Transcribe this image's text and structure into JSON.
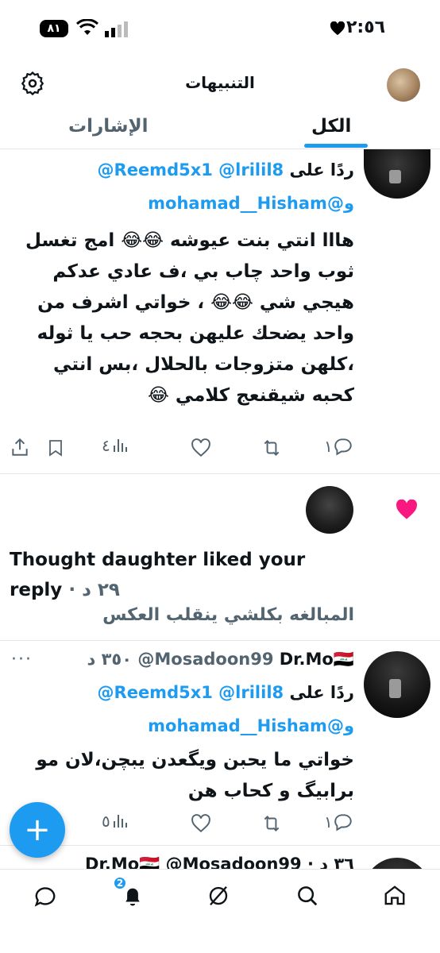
{
  "status_bar": {
    "time": "٢:٥٦",
    "battery": "٨١"
  },
  "header": {
    "title": "التنبيهات",
    "tabs": [
      {
        "label": "الكل"
      },
      {
        "label": "الإشارات"
      }
    ]
  },
  "tweets": [
    {
      "reply_prefix": "ردًا على",
      "mentions_line1": "@Reemd5x1 @lrilil8",
      "mentions_line2": "و@mohamad__Hisham",
      "body": "هااا انتي بنت عيوشه 😂😂 امج تغسل ثوب واحد چاب بي ،ف عادي عدكم هيجي شي 😂😂 ، خواتي اشرف من واحد يضحك عليهن بحجه حب يا ثوله ،كلهن متزوجات بالحلال ،بس انتي كحبه شيقنعج كلامي 😂",
      "replies": "١",
      "views": "٤"
    },
    {
      "name": "Dr.Mo🇮🇶",
      "handle": "@Mosadoon99",
      "time": "٣٥٠ د",
      "reply_prefix": "ردًا على",
      "mentions_line1": "@Reemd5x1 @lrilil8",
      "mentions_line2": "و@mohamad__Hisham",
      "body": "خواتي ما يحبن ويگعدن يبچن،لان مو برابيگ و كحاب هن",
      "replies": "١",
      "views": "٥"
    }
  ],
  "peek_row": {
    "text": "Dr.Mo🇮🇶 @Mosadoon99 · ٣٦ د"
  },
  "like_notification": {
    "text": "Thought daughter liked your reply",
    "time": "· ٢٩ د",
    "quote": "المبالغه بكلشي ينقلب العكس"
  },
  "fab": {
    "label": "+"
  },
  "bottom_nav": {
    "notifications_badge": "2"
  },
  "colors": {
    "accent": "#1d9bf0",
    "like": "#f91880",
    "muted": "#536471",
    "text": "#0f1419"
  },
  "icons": [
    "gear-icon",
    "heart-icon",
    "reply-icon",
    "retweet-icon",
    "like-icon",
    "views-icon",
    "bookmark-icon",
    "share-icon",
    "home-icon",
    "search-icon",
    "grok-icon",
    "bell-icon",
    "messages-icon"
  ]
}
